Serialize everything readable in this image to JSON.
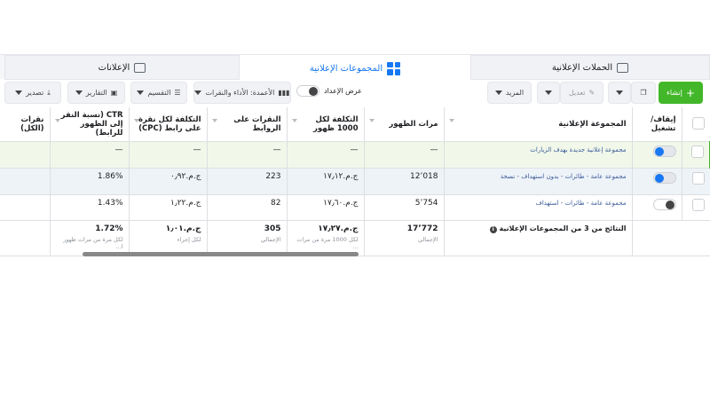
{
  "tabs": [
    {
      "label": "الحملات الإعلانية",
      "icon": "folder-icon"
    },
    {
      "label": "المجموعات الإعلانية",
      "icon": "grid-icon"
    },
    {
      "label": "الإعلانات",
      "icon": "window-icon"
    }
  ],
  "toolbar": {
    "create": "إنشاء",
    "edit": "تعديل",
    "more": "المزيد",
    "setup_toggle": "عرض الإعداد",
    "columns": "الأعمدة: الأداء والنقرات",
    "breakdown": "التقسيم",
    "reports": "التقارير",
    "export": "تصدير"
  },
  "table": {
    "headers": [
      "إيقاف/ تشغيل",
      "المجموعة الإعلانية",
      "مرات الظهور",
      "التكلفة لكل 1000 ظهور",
      "النقرات على الروابط",
      "التكلفة لكل نقرة على رابط (CPC)",
      "CTR (نسبة النقر إلى الظهور للرابط)",
      "نقرات (الكل)"
    ],
    "rows": [
      {
        "on": true,
        "name": "مجموعة إعلانية جديدة بهدف الزيارات",
        "impressions": "—",
        "cpm": "—",
        "link_clicks": "—",
        "cpc": "—",
        "ctr": "—",
        "clicks": ""
      },
      {
        "on": true,
        "name": "مجموعة عامة - طائرات - بدون استهداف - نسخة",
        "impressions": "12٬018",
        "cpm": "ج.م.١٧٫١٢",
        "link_clicks": "223",
        "cpc": "ج.م.٠٫٩٢",
        "ctr": "1.86%",
        "clicks": ""
      },
      {
        "on": false,
        "name": "مجموعة عامة - طائرات - استهداف",
        "impressions": "5٬754",
        "cpm": "ج.م.١٧٫٦٠",
        "link_clicks": "82",
        "cpc": "ج.م.١٫٢٢",
        "ctr": "1.43%",
        "clicks": ""
      }
    ],
    "totals": {
      "label": "النتائج من 3 من المجموعات الإعلانية",
      "impressions": "17٬772",
      "impressions_sub": "الإجمالي",
      "cpm": "ج.م.١٧٫٢٧",
      "cpm_sub": "لكل 1000 مرة من مرات ...",
      "link_clicks": "305",
      "link_clicks_sub": "الإجمالي",
      "cpc": "ج.م.١٫٠١",
      "cpc_sub": "لكل إجراء",
      "ctr": "1.72%",
      "ctr_sub": "لكل مرة من مرات ظهور ا..."
    }
  }
}
